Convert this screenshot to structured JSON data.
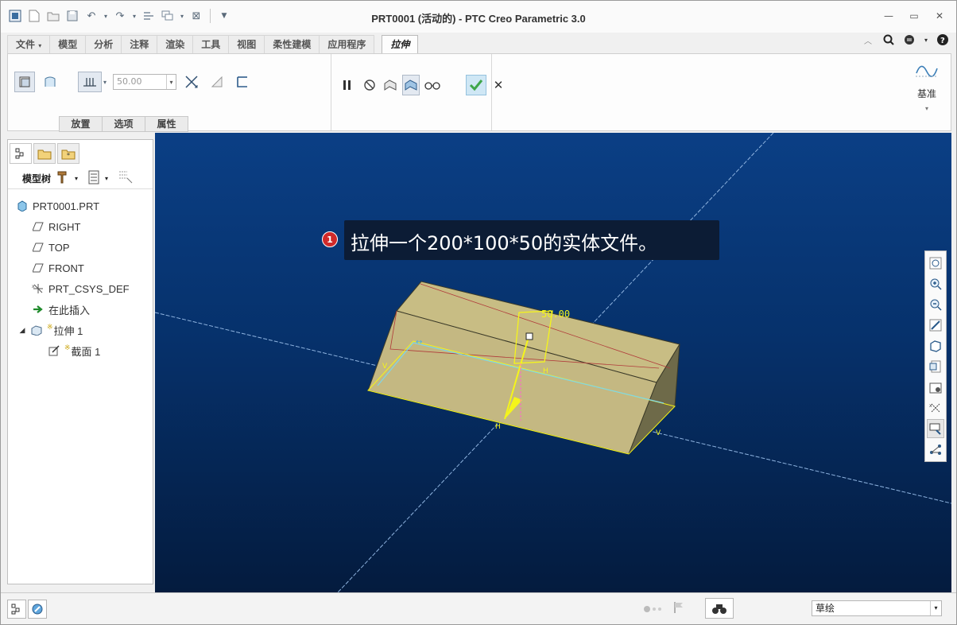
{
  "window": {
    "title": "PRT0001 (活动的) - PTC Creo Parametric 3.0"
  },
  "tabs": [
    "文件",
    "模型",
    "分析",
    "注释",
    "渲染",
    "工具",
    "视图",
    "柔性建模",
    "应用程序"
  ],
  "active_tab": "拉伸",
  "ribbon": {
    "depth_value": "50.00",
    "subtabs": [
      "放置",
      "选项",
      "属性"
    ],
    "datum_label": "基准"
  },
  "model_tree": {
    "toolbar_label": "模型树",
    "items": [
      {
        "label": "PRT0001.PRT",
        "icon": "part-icon"
      },
      {
        "label": "RIGHT",
        "icon": "datum-plane-icon"
      },
      {
        "label": "TOP",
        "icon": "datum-plane-icon"
      },
      {
        "label": "FRONT",
        "icon": "datum-plane-icon"
      },
      {
        "label": "PRT_CSYS_DEF",
        "icon": "csys-icon"
      },
      {
        "label": "在此插入",
        "icon": "insert-here-arrow-icon"
      },
      {
        "label": "拉伸 1",
        "icon": "extrude-icon",
        "expanded": true
      },
      {
        "label": "截面 1",
        "icon": "sketch-icon"
      }
    ]
  },
  "viewport": {
    "callout_number": "1",
    "callout_text": "拉伸一个200*100*50的实体文件。",
    "dimension_text": "50.00"
  },
  "statusbar": {
    "filter_value": "草绘"
  },
  "colors": {
    "accent": "#0b3f85",
    "part": "#c8bd84",
    "sketch": "#f5f51a",
    "ok": "#3fa64a"
  }
}
